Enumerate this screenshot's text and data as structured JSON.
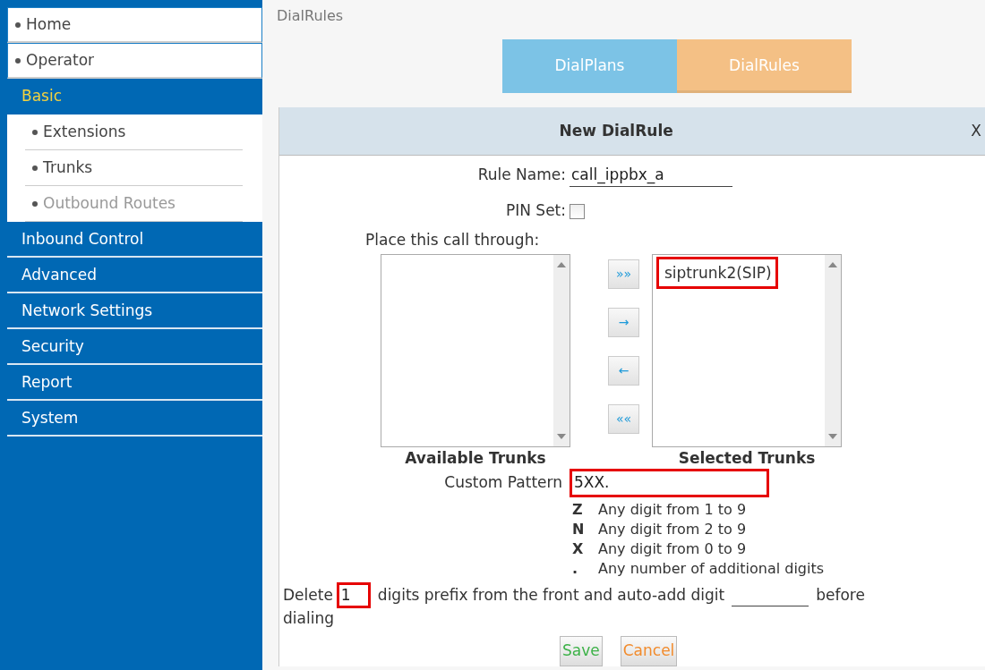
{
  "sidebar": {
    "items": [
      {
        "label": "Home",
        "kind": "link"
      },
      {
        "label": "Operator",
        "kind": "link"
      },
      {
        "label": "Basic",
        "kind": "section",
        "selected": true,
        "children": [
          {
            "label": "Extensions",
            "selected": false
          },
          {
            "label": "Trunks",
            "selected": false
          },
          {
            "label": "Outbound Routes",
            "selected": true
          }
        ]
      },
      {
        "label": "Inbound Control",
        "kind": "section",
        "selected": false
      },
      {
        "label": "Advanced",
        "kind": "section",
        "selected": false
      },
      {
        "label": "Network Settings",
        "kind": "section",
        "selected": false
      },
      {
        "label": "Security",
        "kind": "section",
        "selected": false
      },
      {
        "label": "Report",
        "kind": "section",
        "selected": false
      },
      {
        "label": "System",
        "kind": "section",
        "selected": false
      }
    ]
  },
  "page_title": "DialRules",
  "tabs": [
    {
      "label": "DialPlans",
      "selected": false
    },
    {
      "label": "DialRules",
      "selected": true
    }
  ],
  "dialog": {
    "title": "New DialRule",
    "close": "X",
    "rule_name": {
      "label": "Rule Name:",
      "value": "call_ippbx_a"
    },
    "pin_set": {
      "label": "PIN Set:",
      "checked": false
    },
    "trunks": {
      "label": "Place this call through:",
      "available": {
        "caption": "Available Trunks"
      },
      "selected": {
        "caption": "Selected Trunks",
        "items": [
          {
            "label": "siptrunk2(SIP)",
            "highlighted": true
          }
        ]
      },
      "move_buttons": [
        "»»",
        "→",
        "←",
        "««"
      ]
    },
    "custom_pattern": {
      "label": "Custom Pattern",
      "value": "5XX.",
      "highlighted": true
    },
    "legend": [
      {
        "symbol": "Z",
        "text": "Any digit from 1 to 9"
      },
      {
        "symbol": "N",
        "text": "Any digit from 2 to 9"
      },
      {
        "symbol": "X",
        "text": "Any digit from 0 to 9"
      },
      {
        "symbol": ".",
        "text": "Any number of additional digits"
      }
    ],
    "delete_rule": {
      "before": "Delete",
      "digits": "1",
      "digits_highlighted": true,
      "middle": "digits prefix from the front and auto-add digit",
      "after": "before",
      "continuation": "dialing"
    },
    "buttons": [
      {
        "label": "Save",
        "kind": "save"
      },
      {
        "label": "Cancel",
        "kind": "cancel"
      }
    ]
  }
}
